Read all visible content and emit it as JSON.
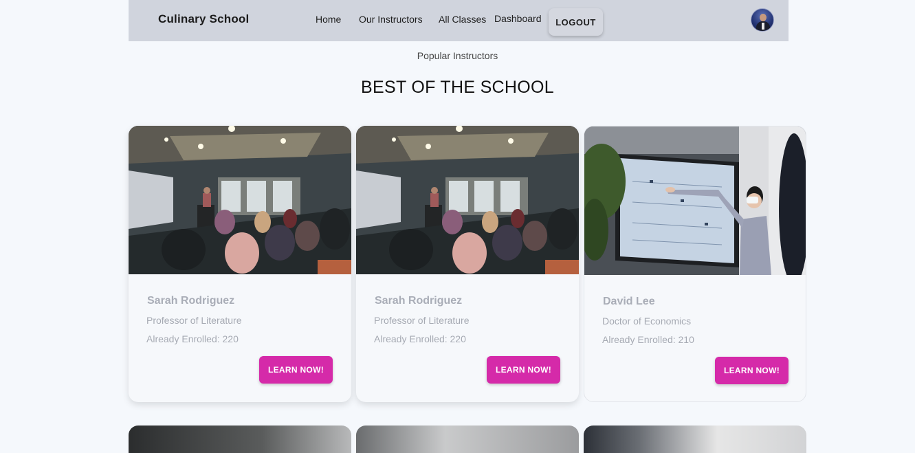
{
  "nav": {
    "brand": "Culinary School",
    "links": [
      "Home",
      "Our Instructors",
      "All Classes",
      "Dashboard"
    ],
    "logout_label": "LOGOUT"
  },
  "section": {
    "subtitle": "Popular Instructors",
    "heading": "BEST OF THE SCHOOL"
  },
  "cards": [
    {
      "name": "Sarah Rodriguez",
      "title": "Professor of Literature",
      "enrolled": "Already Enrolled: 220",
      "button": "LEARN NOW!"
    },
    {
      "name": "Sarah Rodriguez",
      "title": "Professor of Literature",
      "enrolled": "Already Enrolled: 220",
      "button": "LEARN NOW!"
    },
    {
      "name": "David Lee",
      "title": "Doctor of Economics",
      "enrolled": "Already Enrolled: 210",
      "button": "LEARN NOW!"
    }
  ],
  "colors": {
    "navbar": "#d0d4dd",
    "accent": "#d52aa9",
    "background": "#f5f8fc"
  }
}
